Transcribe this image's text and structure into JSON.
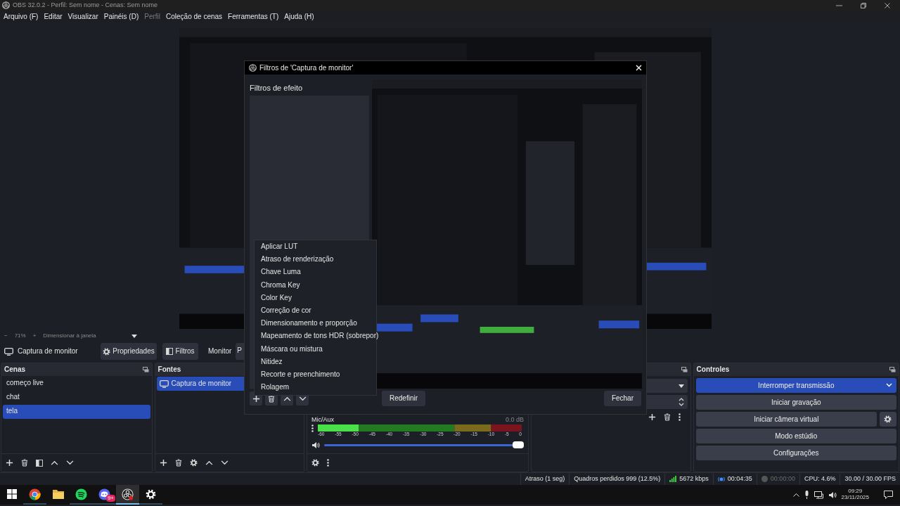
{
  "window": {
    "title": "OBS 32.0.2 - Perfil: Sem nome - Cenas: Sem nome"
  },
  "menu": [
    {
      "label": "Arquivo (F)",
      "disabled": false
    },
    {
      "label": "Editar",
      "disabled": false
    },
    {
      "label": "Visualizar",
      "disabled": false
    },
    {
      "label": "Painéis (D)",
      "disabled": false
    },
    {
      "label": "Perfil",
      "disabled": true
    },
    {
      "label": "Coleção de cenas",
      "disabled": false
    },
    {
      "label": "Ferramentas (T)",
      "disabled": false
    },
    {
      "label": "Ajuda (H)",
      "disabled": false
    }
  ],
  "zoom_bar": {
    "minus": "−",
    "zoom": "71%",
    "plus": "+",
    "fit": "Dimensionar à janela"
  },
  "source_toolbar": {
    "source": "Captura de monitor",
    "buttons": [
      {
        "label": "Propriedades"
      },
      {
        "label": "Filtros"
      }
    ],
    "monitor_label": "Monitor",
    "monitor_value": "P"
  },
  "scenes": {
    "title": "Cenas",
    "items": [
      {
        "label": "começo live",
        "selected": false
      },
      {
        "label": "chat",
        "selected": false
      },
      {
        "label": "tela",
        "selected": true
      }
    ]
  },
  "sources": {
    "title": "Fontes",
    "items": [
      {
        "label": "Captura de monitor",
        "selected": true
      }
    ]
  },
  "mixer": {
    "channels": [
      {
        "name": "Mic/Aux",
        "reading": "0.0 dB",
        "meter": {
          "level": 0.2
        },
        "volume": {
          "level": 1
        },
        "scale": [
          "-60",
          "-55",
          "-50",
          "-45",
          "-40",
          "-35",
          "-30",
          "-25",
          "-20",
          "-15",
          "-10",
          "-5",
          "0"
        ]
      }
    ]
  },
  "controls": {
    "title": "Controles",
    "buttons": [
      {
        "label": "Interromper transmissão",
        "active": true,
        "dropdown": true,
        "settings": false
      },
      {
        "label": "Iniciar gravação",
        "active": false,
        "dropdown": false,
        "settings": false
      },
      {
        "label": "Iniciar câmera virtual",
        "active": false,
        "dropdown": false,
        "settings": true
      },
      {
        "label": "Modo estúdio",
        "active": false,
        "dropdown": false,
        "settings": false
      },
      {
        "label": "Configurações",
        "active": false,
        "dropdown": false,
        "settings": false
      }
    ]
  },
  "status_bar": [
    {
      "kind": "text",
      "text": "Atraso (1 seg)"
    },
    {
      "kind": "bitrate_label",
      "text": "Quadros perdidos 999 (12.5%)"
    },
    {
      "kind": "bitrate",
      "text": "5672 kbps"
    },
    {
      "kind": "stream",
      "text": "00:04:35",
      "active": true
    },
    {
      "kind": "record",
      "text": "00:00:00",
      "active": false
    },
    {
      "kind": "text",
      "text": "CPU: 4.6%"
    },
    {
      "kind": "text",
      "text": "30.00 / 30.00 FPS"
    }
  ],
  "taskbar": {
    "apps": [
      {
        "kind": "start",
        "running": false,
        "selected": false
      },
      {
        "kind": "browser",
        "running": true,
        "selected": false
      },
      {
        "kind": "folder",
        "running": false,
        "selected": false
      },
      {
        "kind": "music",
        "running": true,
        "selected": false
      },
      {
        "kind": "chat",
        "running": true,
        "selected": false,
        "badge": "9+"
      },
      {
        "kind": "obs",
        "running": true,
        "selected": true
      },
      {
        "kind": "settings",
        "running": true,
        "selected": false
      }
    ],
    "time": "09:29",
    "date": "23/11/2025"
  },
  "dialog": {
    "title": "Filtros de 'Captura de monitor'",
    "section": "Filtros de efeito",
    "reset": "Redefinir",
    "close": "Fechar"
  },
  "filter_menu": {
    "items": [
      "Aplicar LUT",
      "Atraso de renderização",
      "Chave Luma",
      "Chroma Key",
      "Color Key",
      "Correção de cor",
      "Dimensionamento e proporção",
      "Mapeamento de tons HDR (sobrepor)",
      "Máscara ou mistura",
      "Nitidez",
      "Recorte e preenchimento",
      "Rolagem"
    ]
  }
}
